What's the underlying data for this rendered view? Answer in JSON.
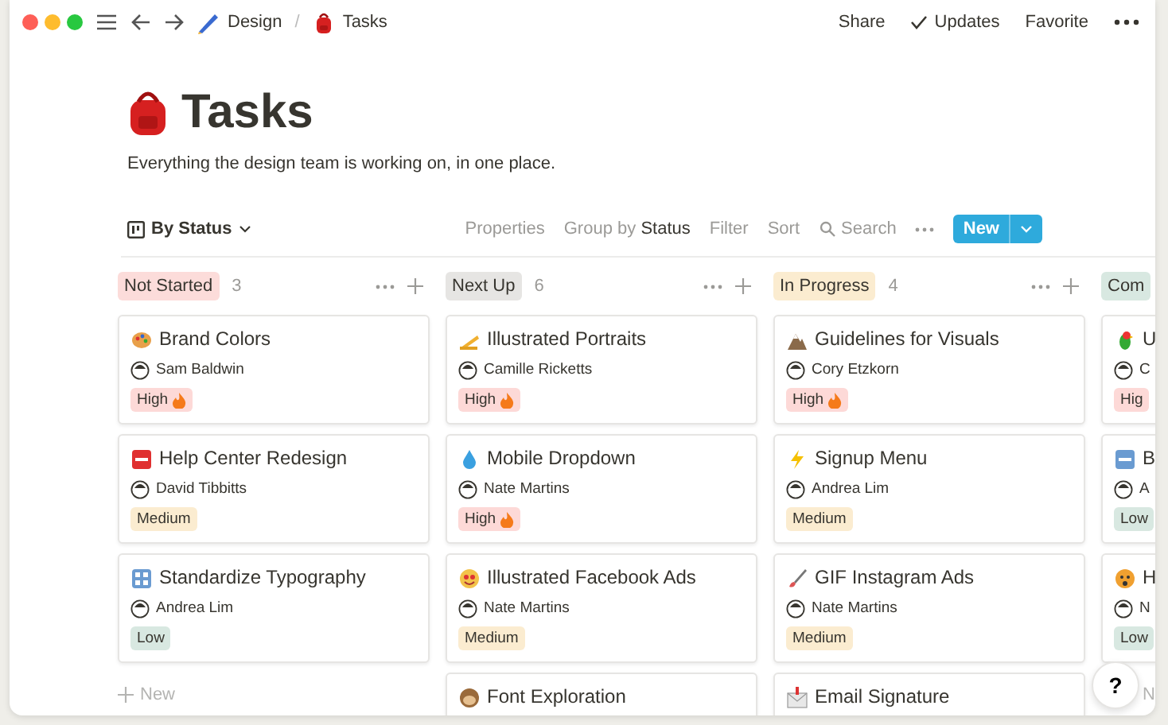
{
  "breadcrumb": [
    {
      "label": "Design"
    },
    {
      "label": "Tasks"
    }
  ],
  "breadcrumb_separator": "/",
  "top_actions": [
    {
      "label": "Share",
      "kind": "plain"
    },
    {
      "label": "Updates",
      "kind": "check"
    },
    {
      "label": "Favorite",
      "kind": "plain"
    }
  ],
  "page": {
    "title": "Tasks",
    "description": "Everything the design team is working on, in one place."
  },
  "view": {
    "label": "By Status"
  },
  "toolbar": {
    "properties": "Properties",
    "group_by": "Group by",
    "group_value": "Status",
    "filter": "Filter",
    "sort": "Sort",
    "search": "Search",
    "new_button": "New"
  },
  "columns": [
    {
      "label": "Not Started",
      "count": "3",
      "color": "#fcdcda",
      "menu": true,
      "new_label": "New",
      "cards": [
        {
          "title": "Brand Colors",
          "assignee": "Sam Baldwin",
          "priority": {
            "label": "High",
            "kind": "high"
          }
        },
        {
          "title": "Help Center Redesign",
          "assignee": "David Tibbitts",
          "priority": {
            "label": "Medium",
            "kind": "medium"
          }
        },
        {
          "title": "Standardize Typography",
          "assignee": "Andrea Lim",
          "priority": {
            "label": "Low",
            "kind": "low"
          }
        }
      ]
    },
    {
      "label": "Next Up",
      "count": "6",
      "color": "#e6e5e3",
      "menu": true,
      "cards": [
        {
          "title": "Illustrated Portraits",
          "assignee": "Camille Ricketts",
          "priority": {
            "label": "High",
            "kind": "high"
          }
        },
        {
          "title": "Mobile Dropdown",
          "assignee": "Nate Martins",
          "priority": {
            "label": "High",
            "kind": "high"
          }
        },
        {
          "title": "Illustrated Facebook Ads",
          "assignee": "Nate Martins",
          "priority": {
            "label": "Medium",
            "kind": "medium"
          }
        },
        {
          "title": "Font Exploration"
        }
      ]
    },
    {
      "label": "In Progress",
      "count": "4",
      "color": "#fbecd0",
      "menu": true,
      "cards": [
        {
          "title": "Guidelines for Visuals",
          "assignee": "Cory Etzkorn",
          "priority": {
            "label": "High",
            "kind": "high"
          }
        },
        {
          "title": "Signup Menu",
          "assignee": "Andrea Lim",
          "priority": {
            "label": "Medium",
            "kind": "medium"
          }
        },
        {
          "title": "GIF Instagram Ads",
          "assignee": "Nate Martins",
          "priority": {
            "label": "Medium",
            "kind": "medium"
          }
        },
        {
          "title": "Email Signature"
        }
      ]
    },
    {
      "label": "Com",
      "color": "#d8e8e1",
      "new_label": "N",
      "cards": [
        {
          "title": "U",
          "assignee": "C",
          "priority": {
            "label": "Hig",
            "kind": "high_cut"
          }
        },
        {
          "title": "B",
          "assignee": "A",
          "priority": {
            "label": "Low",
            "kind": "low"
          }
        },
        {
          "title": "H",
          "assignee": "N",
          "priority": {
            "label": "Low",
            "kind": "low"
          }
        }
      ]
    }
  ],
  "help_button": "?"
}
